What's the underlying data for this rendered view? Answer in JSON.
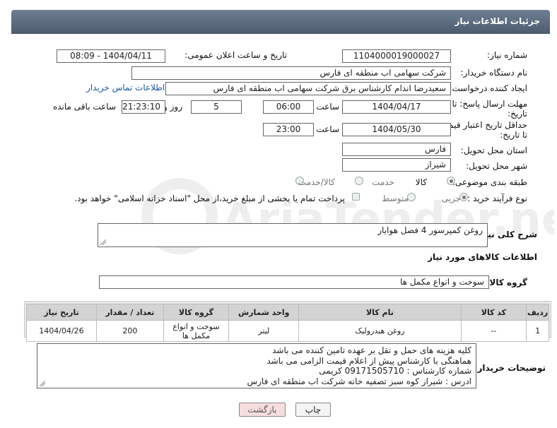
{
  "header": {
    "title": "جزئیات اطلاعات نیاز"
  },
  "fields": {
    "need_number_label": "شماره نیاز:",
    "need_number": "1104000019000027",
    "announce_label": "تاریخ و ساعت اعلان عمومی:",
    "announce_value": "1404/04/11 - 08:09",
    "buyer_org_label": "نام دستگاه خریدار:",
    "buyer_org": "شرکت سهامی اب منطقه ای فارس",
    "creator_label": "ایجاد کننده درخواست:",
    "creator": "سعیدرضا اندام کارشناس برق شرکت سهامی اب منطقه ای فارس",
    "contact_link": "اطلاعات تماس خریدار",
    "deadline_label": "مهلت ارسال پاسخ: تا تاریخ:",
    "deadline_date": "1404/04/17",
    "time_label": "ساعت",
    "deadline_time": "06:00",
    "days_value": "5",
    "days_label": "روز و",
    "remaining_time": "21:23:10",
    "remaining_label": "ساعت باقی مانده",
    "validity_label": "حداقل تاریخ اعتبار قیمت: تا تاریخ:",
    "validity_date": "1404/05/30",
    "validity_time": "23:00",
    "province_label": "استان محل تحویل:",
    "province": "فارس",
    "city_label": "شهر محل تحویل:",
    "city": "شیراز",
    "category_label": "طبقه بندی موضوعی:",
    "cat_goods": "کالا",
    "cat_service": "خدمت",
    "cat_goods_service": "کالا/خدمت",
    "process_label": "نوع فرآیند خرید :",
    "proc_partial": "جزیی",
    "proc_medium": "متوسط",
    "payment_note": "پرداخت تمام یا بخشی از مبلغ خرید،از محل \"اسناد خزانه اسلامی\" خواهد بود."
  },
  "description": {
    "label": "شرح کلی نیاز:",
    "value": "روغن کمپرسور 4 فصل هوایار"
  },
  "goods_section": {
    "title": "اطلاعات کالاهای مورد نیاز",
    "group_label": "گروه کالا:",
    "group_value": "سوخت و انواع مکمل ها"
  },
  "table": {
    "headers": [
      "ردیف",
      "کد کالا",
      "نام کالا",
      "واحد شمارش",
      "گروه کالا",
      "تعداد / مقدار",
      "تاریخ نیاز"
    ],
    "rows": [
      [
        "1",
        "--",
        "روغن هیدرولیک",
        "لیتر",
        "سوخت و انواع مکمل ها",
        "200",
        "1404/04/26"
      ]
    ]
  },
  "buyer_notes": {
    "label": "توضیحات خریدار:",
    "lines": [
      "کلیه هزینه های حمل و نقل بر عهده تامین کننده می باشد",
      "هماهنگی با کارشناس پیش از اعلام قیمت الزامی می باشد",
      "شماره کارشناس : 09171505710 کریمی",
      "ادرس : شیراز کوه سبز تصفیه خانه شرکت اب منطقه ای فارس"
    ]
  },
  "buttons": {
    "print": "چاپ",
    "back": "بازگشت"
  },
  "watermark": "AriaTender.net",
  "colors": {
    "header": "#5a697c",
    "link": "#1a57b0",
    "back_button": "#f7dede"
  }
}
